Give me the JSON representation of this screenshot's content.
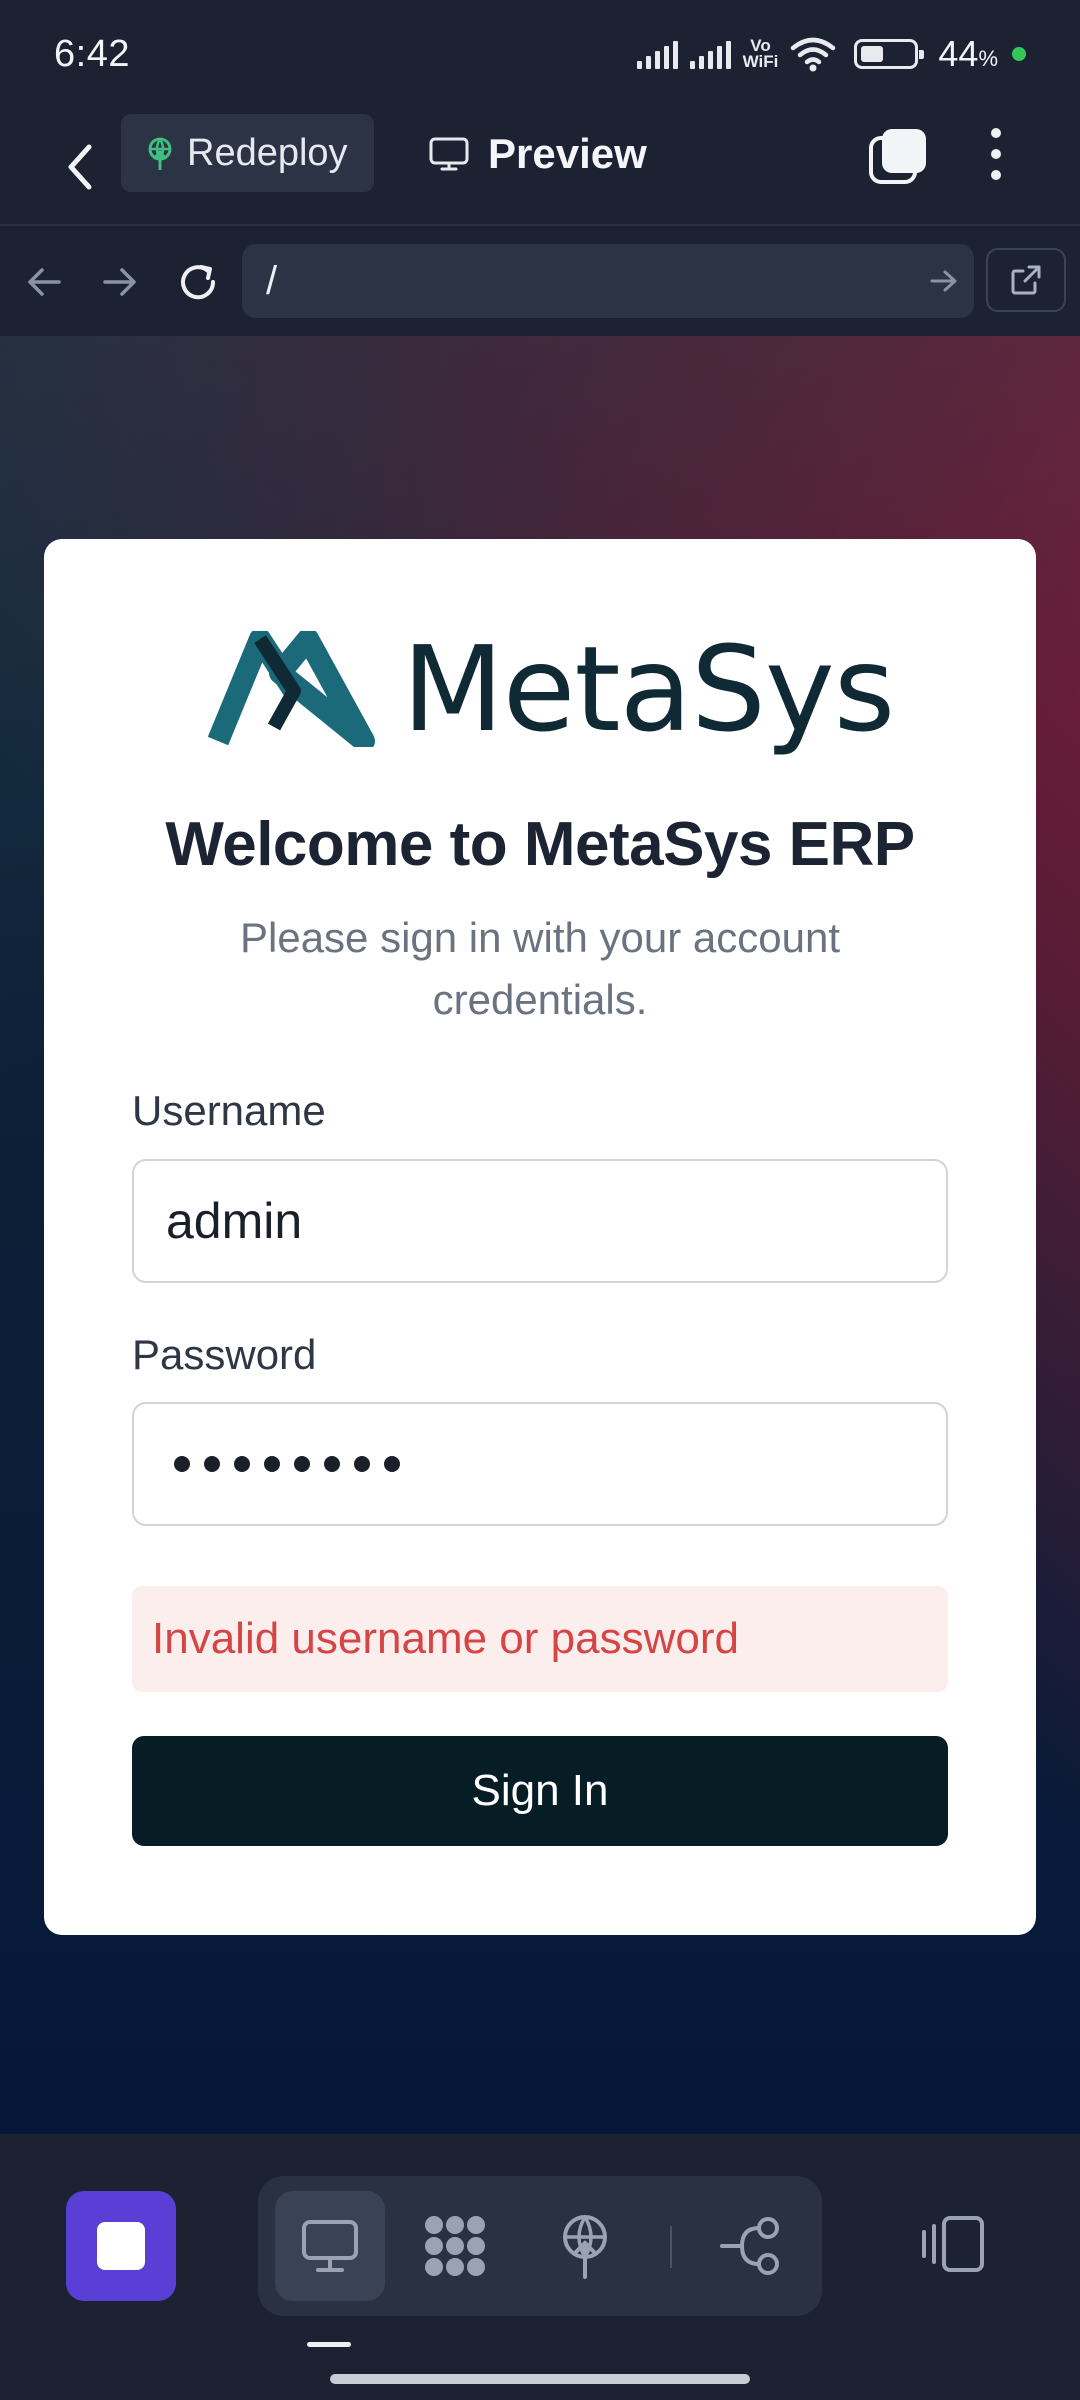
{
  "status_bar": {
    "time": "6:42",
    "network_label": "Vo\nWiFi",
    "battery_percent": "44",
    "battery_unit": "%",
    "battery_level": 0.44
  },
  "header": {
    "redeploy_label": "Redeploy",
    "preview_label": "Preview"
  },
  "browser": {
    "url": "/"
  },
  "login": {
    "logo_text": "MetaSys",
    "title": "Welcome to MetaSys ERP",
    "subtitle": "Please sign in with your account credentials.",
    "username_label": "Username",
    "username_value": "admin",
    "password_label": "Password",
    "password_length": 8,
    "error_message": "Invalid username or password",
    "submit_label": "Sign In"
  },
  "dock": {
    "items": [
      "monitor-icon",
      "grid-blobs-icon",
      "deploy-icon",
      "branch-icon"
    ],
    "active_item": "monitor-icon"
  },
  "colors": {
    "accent": "#5a3fd6",
    "error": "#d64545",
    "logo": "#1b6a7a",
    "button": "#061d26"
  }
}
